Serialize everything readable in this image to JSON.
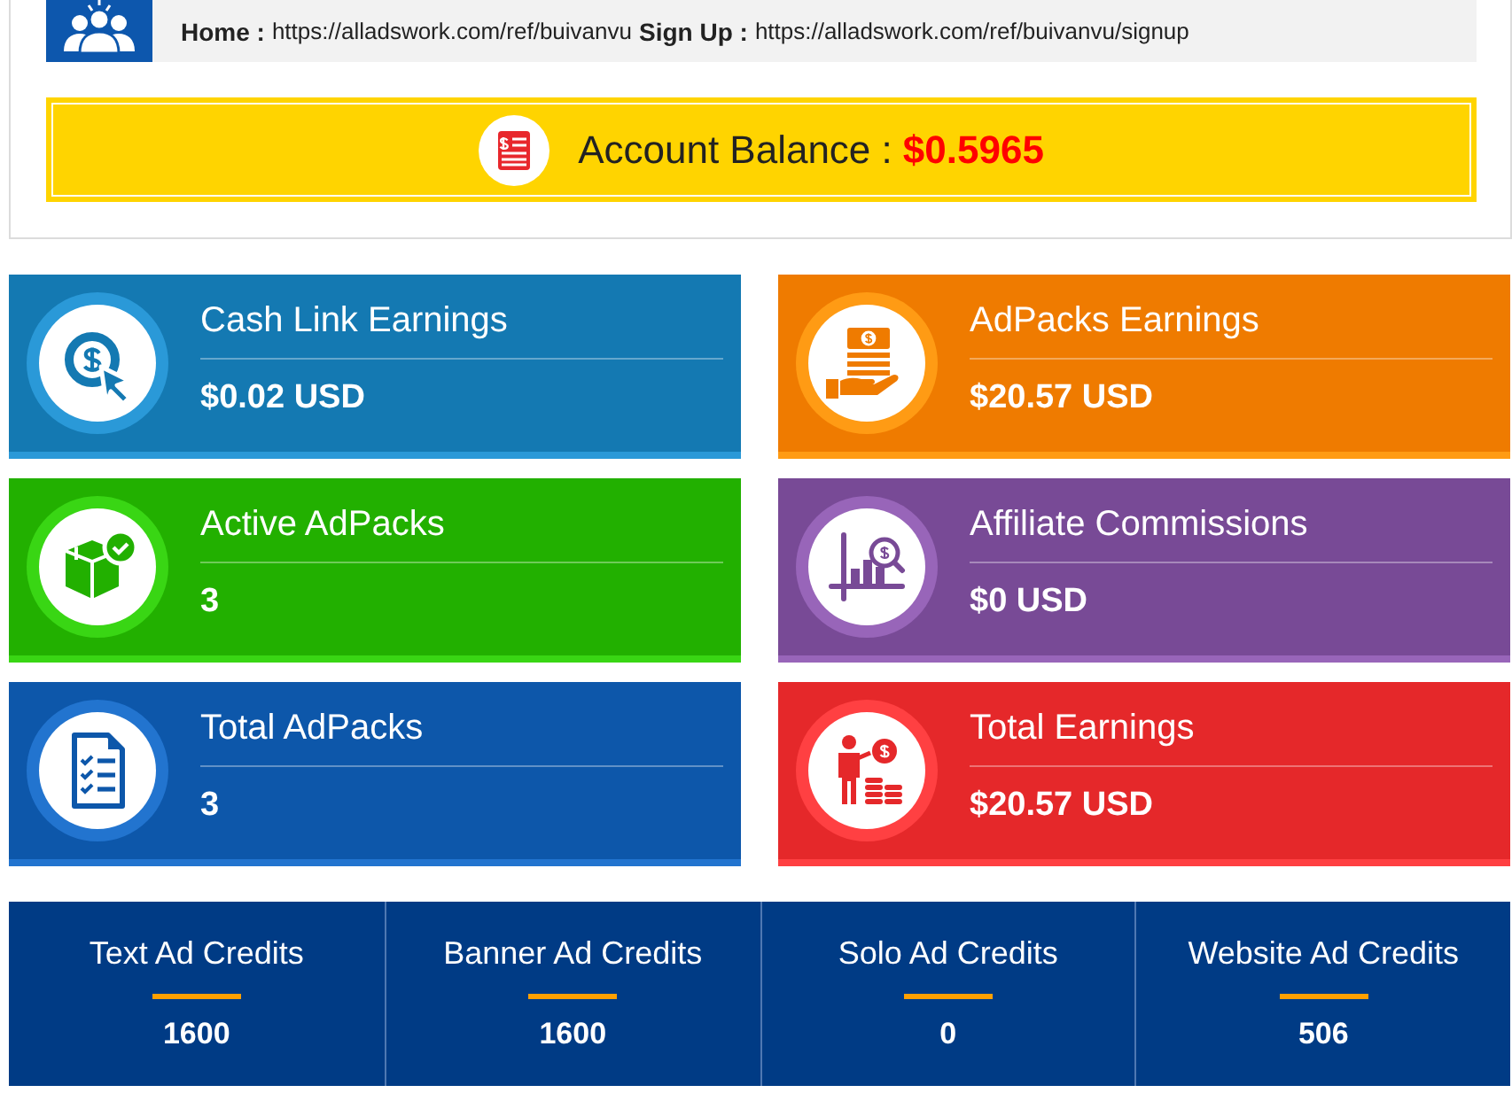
{
  "referral_bar": {
    "home_label": "Home :",
    "home_url": "https://alladswork.com/ref/buivanvu",
    "signup_label": "Sign Up :",
    "signup_url": "https://alladswork.com/ref/buivanvu/signup"
  },
  "balance": {
    "label": "Account Balance :",
    "value": "$0.5965"
  },
  "stat_cards": [
    {
      "kind": "click",
      "title": "Cash Link Earnings",
      "value": "$0.02 USD",
      "color": "#1479b2"
    },
    {
      "kind": "cash",
      "title": "AdPacks Earnings",
      "value": "$20.57 USD",
      "color": "#ef7b00"
    },
    {
      "kind": "box",
      "title": "Active AdPacks",
      "value": "3",
      "color": "#22b000"
    },
    {
      "kind": "chart",
      "title": "Affiliate Commissions",
      "value": "$0 USD",
      "color": "#784a96"
    },
    {
      "kind": "checklist",
      "title": "Total AdPacks",
      "value": "3",
      "color": "#0d57aa"
    },
    {
      "kind": "investor",
      "title": "Total Earnings",
      "value": "$20.57 USD",
      "color": "#e5282a"
    }
  ],
  "credits": [
    {
      "label": "Text Ad Credits",
      "value": "1600"
    },
    {
      "label": "Banner Ad Credits",
      "value": "1600"
    },
    {
      "label": "Solo Ad Credits",
      "value": "0"
    },
    {
      "label": "Website Ad Credits",
      "value": "506"
    }
  ]
}
